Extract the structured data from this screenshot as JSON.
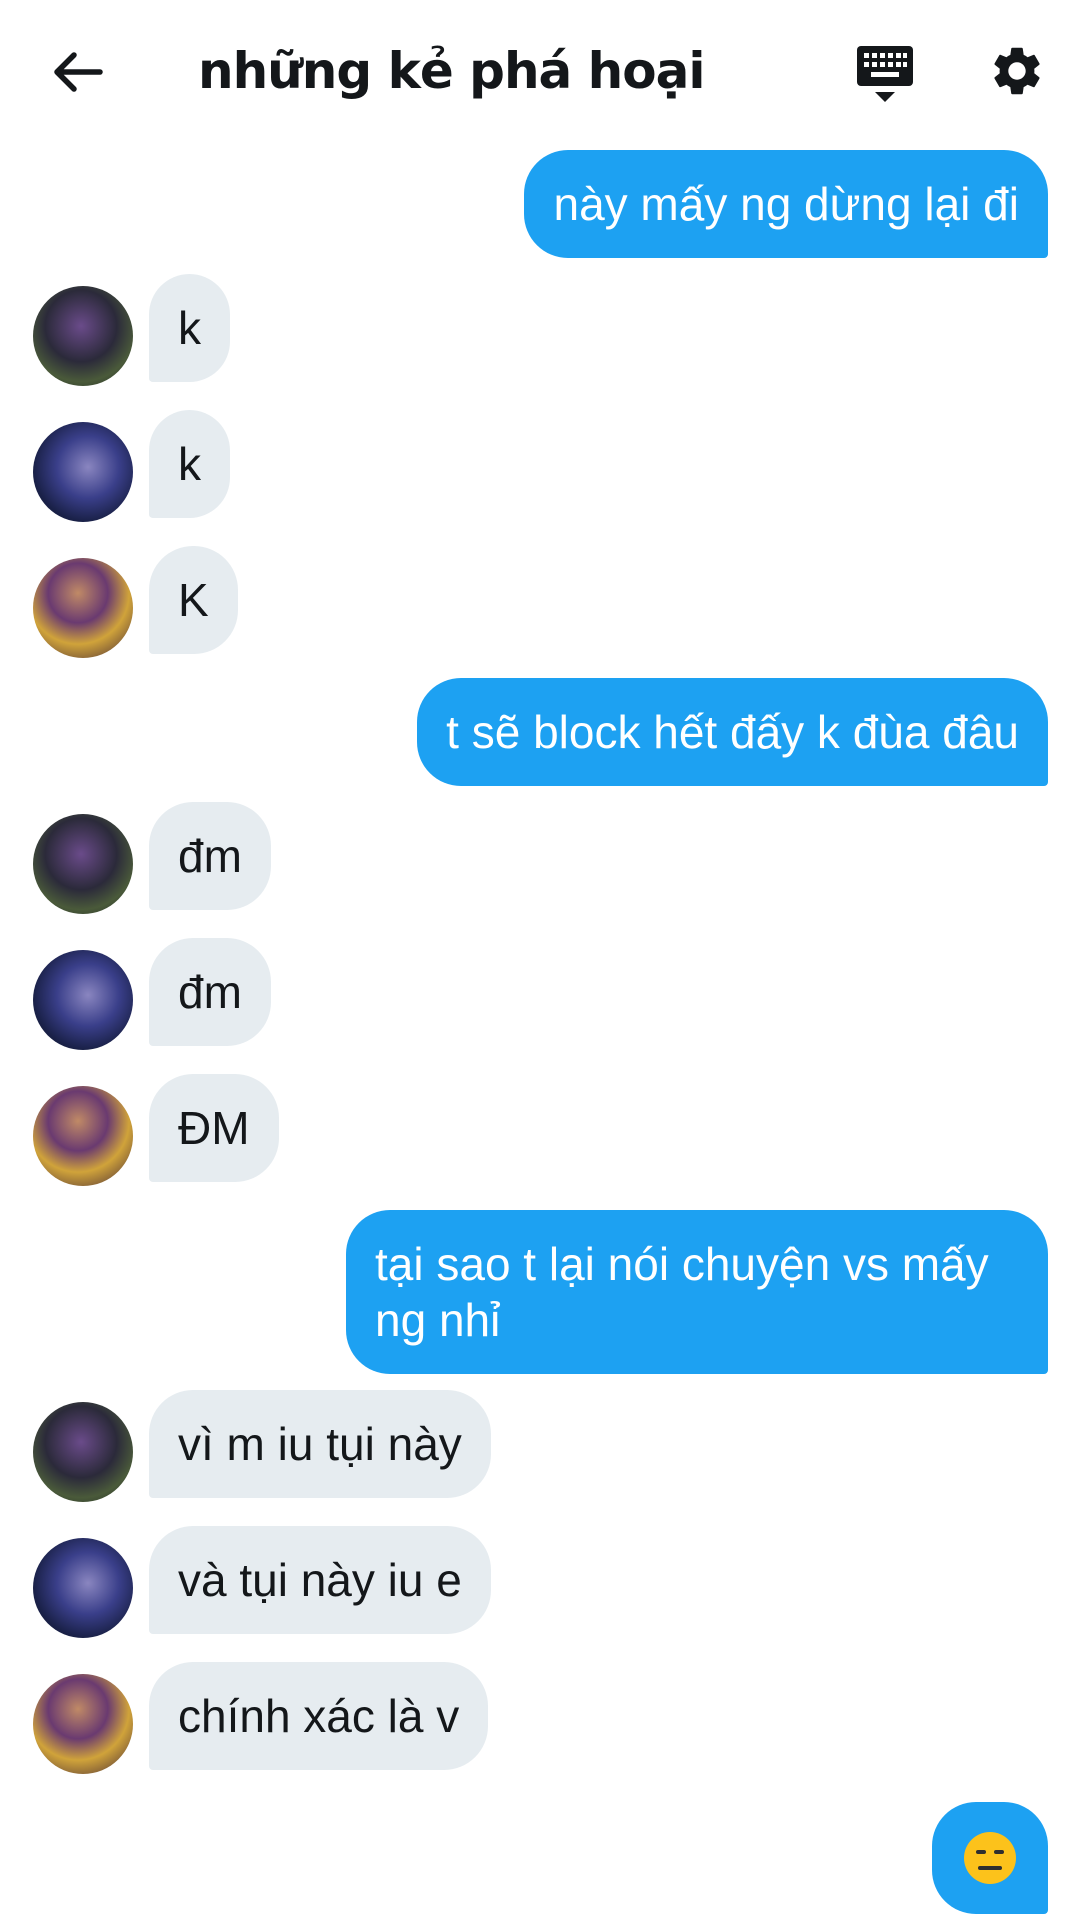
{
  "header": {
    "title": "những kẻ phá hoại",
    "back_icon": "arrow-left-icon",
    "keyboard_icon": "keyboard-hide-icon",
    "settings_icon": "gear-icon"
  },
  "colors": {
    "outgoing_bubble": "#1da1f2",
    "incoming_bubble": "#e6ecf0",
    "text": "#14171a"
  },
  "messages": [
    {
      "direction": "out",
      "text": "này mấy ng dừng lại đi"
    },
    {
      "direction": "in",
      "avatar": "avatar-1",
      "text": "k"
    },
    {
      "direction": "in",
      "avatar": "avatar-2",
      "text": "k"
    },
    {
      "direction": "in",
      "avatar": "avatar-3",
      "text": "K"
    },
    {
      "direction": "out",
      "text": "t sẽ block hết đấy k đùa đâu"
    },
    {
      "direction": "in",
      "avatar": "avatar-1",
      "text": "đm"
    },
    {
      "direction": "in",
      "avatar": "avatar-2",
      "text": "đm"
    },
    {
      "direction": "in",
      "avatar": "avatar-3",
      "text": "ĐM"
    },
    {
      "direction": "out",
      "text_line1": "tại sao t lại nói chuyện vs mấy",
      "text_line2": "ng nhỉ"
    },
    {
      "direction": "in",
      "avatar": "avatar-1",
      "text": "vì m iu tụi này"
    },
    {
      "direction": "in",
      "avatar": "avatar-2",
      "text": "và tụi này iu e"
    },
    {
      "direction": "in",
      "avatar": "avatar-3",
      "text": "chính xác là v"
    },
    {
      "direction": "out",
      "emoji": "expressionless-face-icon"
    }
  ]
}
